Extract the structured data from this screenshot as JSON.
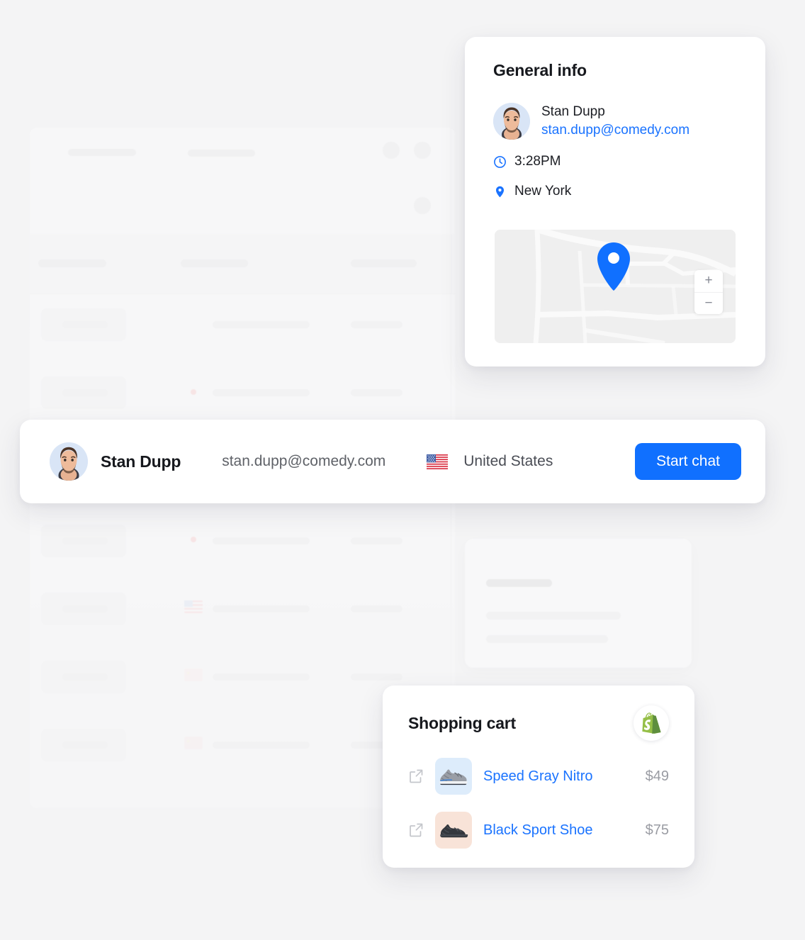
{
  "theme": {
    "page_bg": "#f4f4f5",
    "accent_blue": "#1070ff",
    "link_blue": "#1a73ff",
    "text_dark": "#16181d",
    "text_muted": "#5f6268",
    "price_gray": "#9a9ca3",
    "shopify_green": "#95bf47",
    "avatar_bg": "#d9e5f6",
    "map_bg": "#efefef"
  },
  "general_info": {
    "title": "General info",
    "person": {
      "name": "Stan Dupp",
      "email": "stan.dupp@comedy.com",
      "avatar_icon": "user-avatar"
    },
    "time": {
      "icon": "clock-icon",
      "value": "3:28PM"
    },
    "location": {
      "icon": "map-pin-icon",
      "value": "New York"
    },
    "map": {
      "pin_icon": "map-pin-marker",
      "zoom_in_label": "+",
      "zoom_out_label": "−"
    }
  },
  "user_bar": {
    "avatar_icon": "user-avatar",
    "name": "Stan Dupp",
    "email": "stan.dupp@comedy.com",
    "country_flag_icon": "flag-united-states",
    "country": "United States",
    "start_chat_label": "Start chat"
  },
  "shopping_cart": {
    "title": "Shopping cart",
    "provider_icon": "shopify-logo",
    "items": [
      {
        "open_icon": "external-link-icon",
        "thumb_icon": "sneaker-gray-icon",
        "thumb_bg": "#ddecfb",
        "name": "Speed Gray Nitro",
        "price": "$49"
      },
      {
        "open_icon": "external-link-icon",
        "thumb_icon": "sneaker-black-icon",
        "thumb_bg": "#f8e3d8",
        "name": "Black Sport Shoe",
        "price": "$75"
      }
    ]
  }
}
